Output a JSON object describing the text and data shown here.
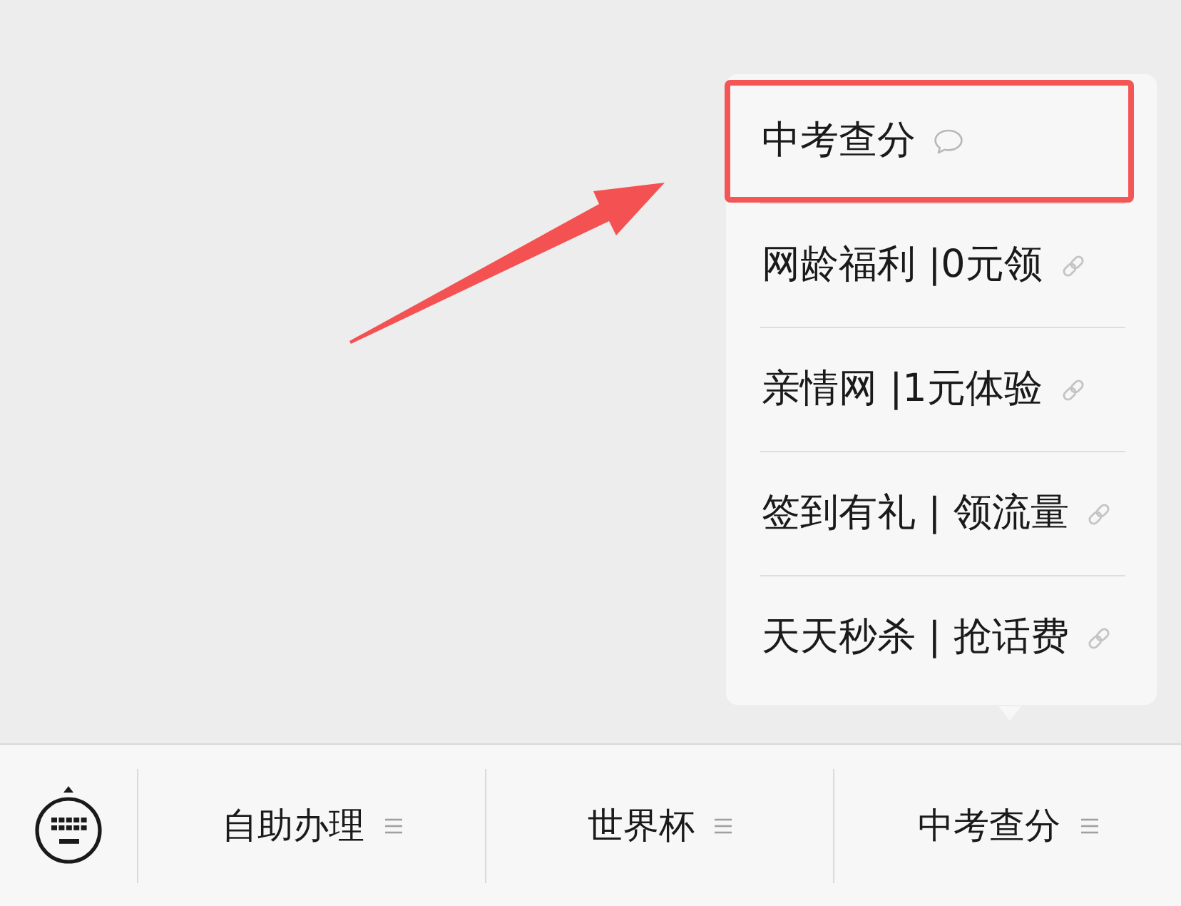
{
  "popup_menu": {
    "items": [
      {
        "label": "中考查分",
        "kind": "message",
        "highlighted": true
      },
      {
        "label": "网龄福利 |0元领",
        "kind": "link",
        "highlighted": false
      },
      {
        "label": "亲情网 |1元体验",
        "kind": "link",
        "highlighted": false
      },
      {
        "label": "签到有礼 | 领流量",
        "kind": "link",
        "highlighted": false
      },
      {
        "label": "天天秒杀 | 抢话费",
        "kind": "link",
        "highlighted": false
      }
    ]
  },
  "bottom_menu": {
    "items": [
      {
        "label": "自助办理"
      },
      {
        "label": "世界杯"
      },
      {
        "label": "中考查分"
      }
    ]
  }
}
